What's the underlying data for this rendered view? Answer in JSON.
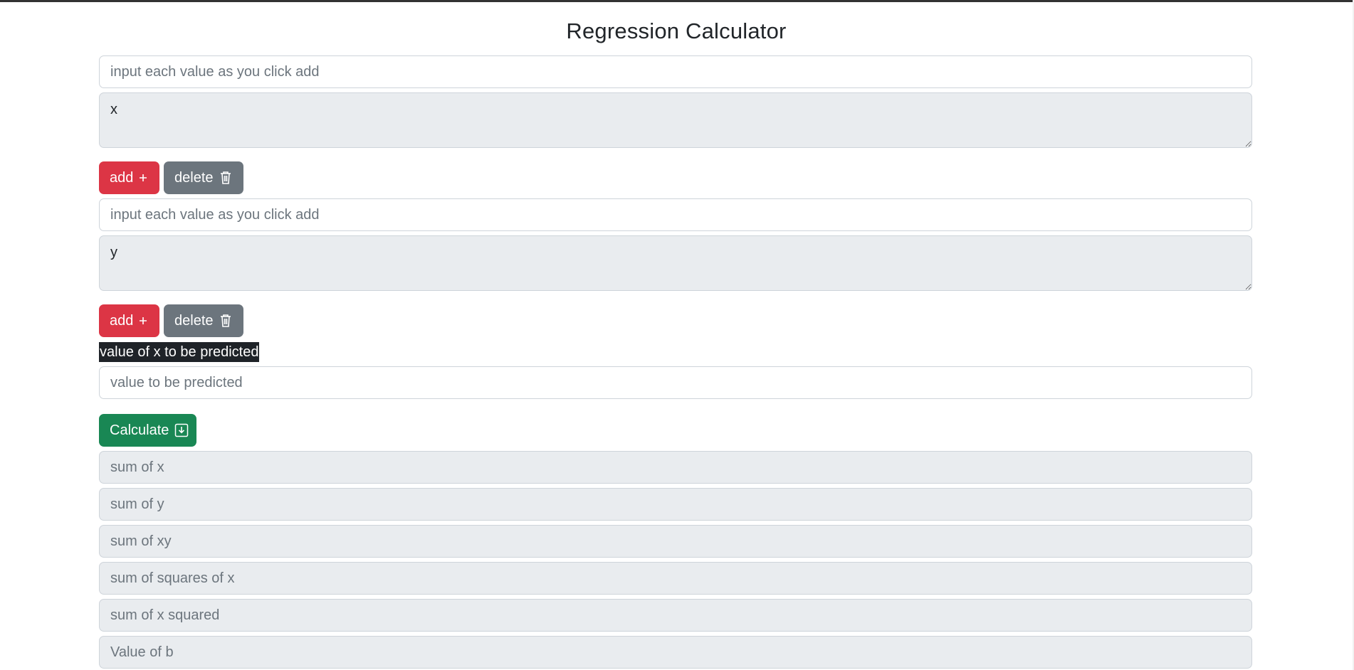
{
  "page": {
    "title": "Regression Calculator"
  },
  "x_section": {
    "input_placeholder": "input each value as you click add",
    "textarea_placeholder": "x",
    "add_label": "add",
    "delete_label": "delete"
  },
  "y_section": {
    "input_placeholder": "input each value as you click add",
    "textarea_placeholder": "y",
    "add_label": "add",
    "delete_label": "delete"
  },
  "predict": {
    "label": "value of x to be predicted",
    "input_placeholder": "value to be predicted"
  },
  "calculate": {
    "label": "Calculate"
  },
  "results": {
    "sum_x_placeholder": "sum of x",
    "sum_y_placeholder": "sum of y",
    "sum_xy_placeholder": "sum of xy",
    "sum_squares_x_placeholder": "sum of squares of x",
    "sum_x_squared_placeholder": "sum of x squared",
    "value_b_placeholder": "Value of b"
  },
  "icons": {
    "add": "plus-icon",
    "delete": "trash-icon",
    "calculate": "download-box-icon"
  },
  "colors": {
    "add": "#dc3545",
    "delete": "#6c757d",
    "calculate": "#198754",
    "readonly_bg": "#e9ecef",
    "label_highlight": "#1f2328"
  }
}
